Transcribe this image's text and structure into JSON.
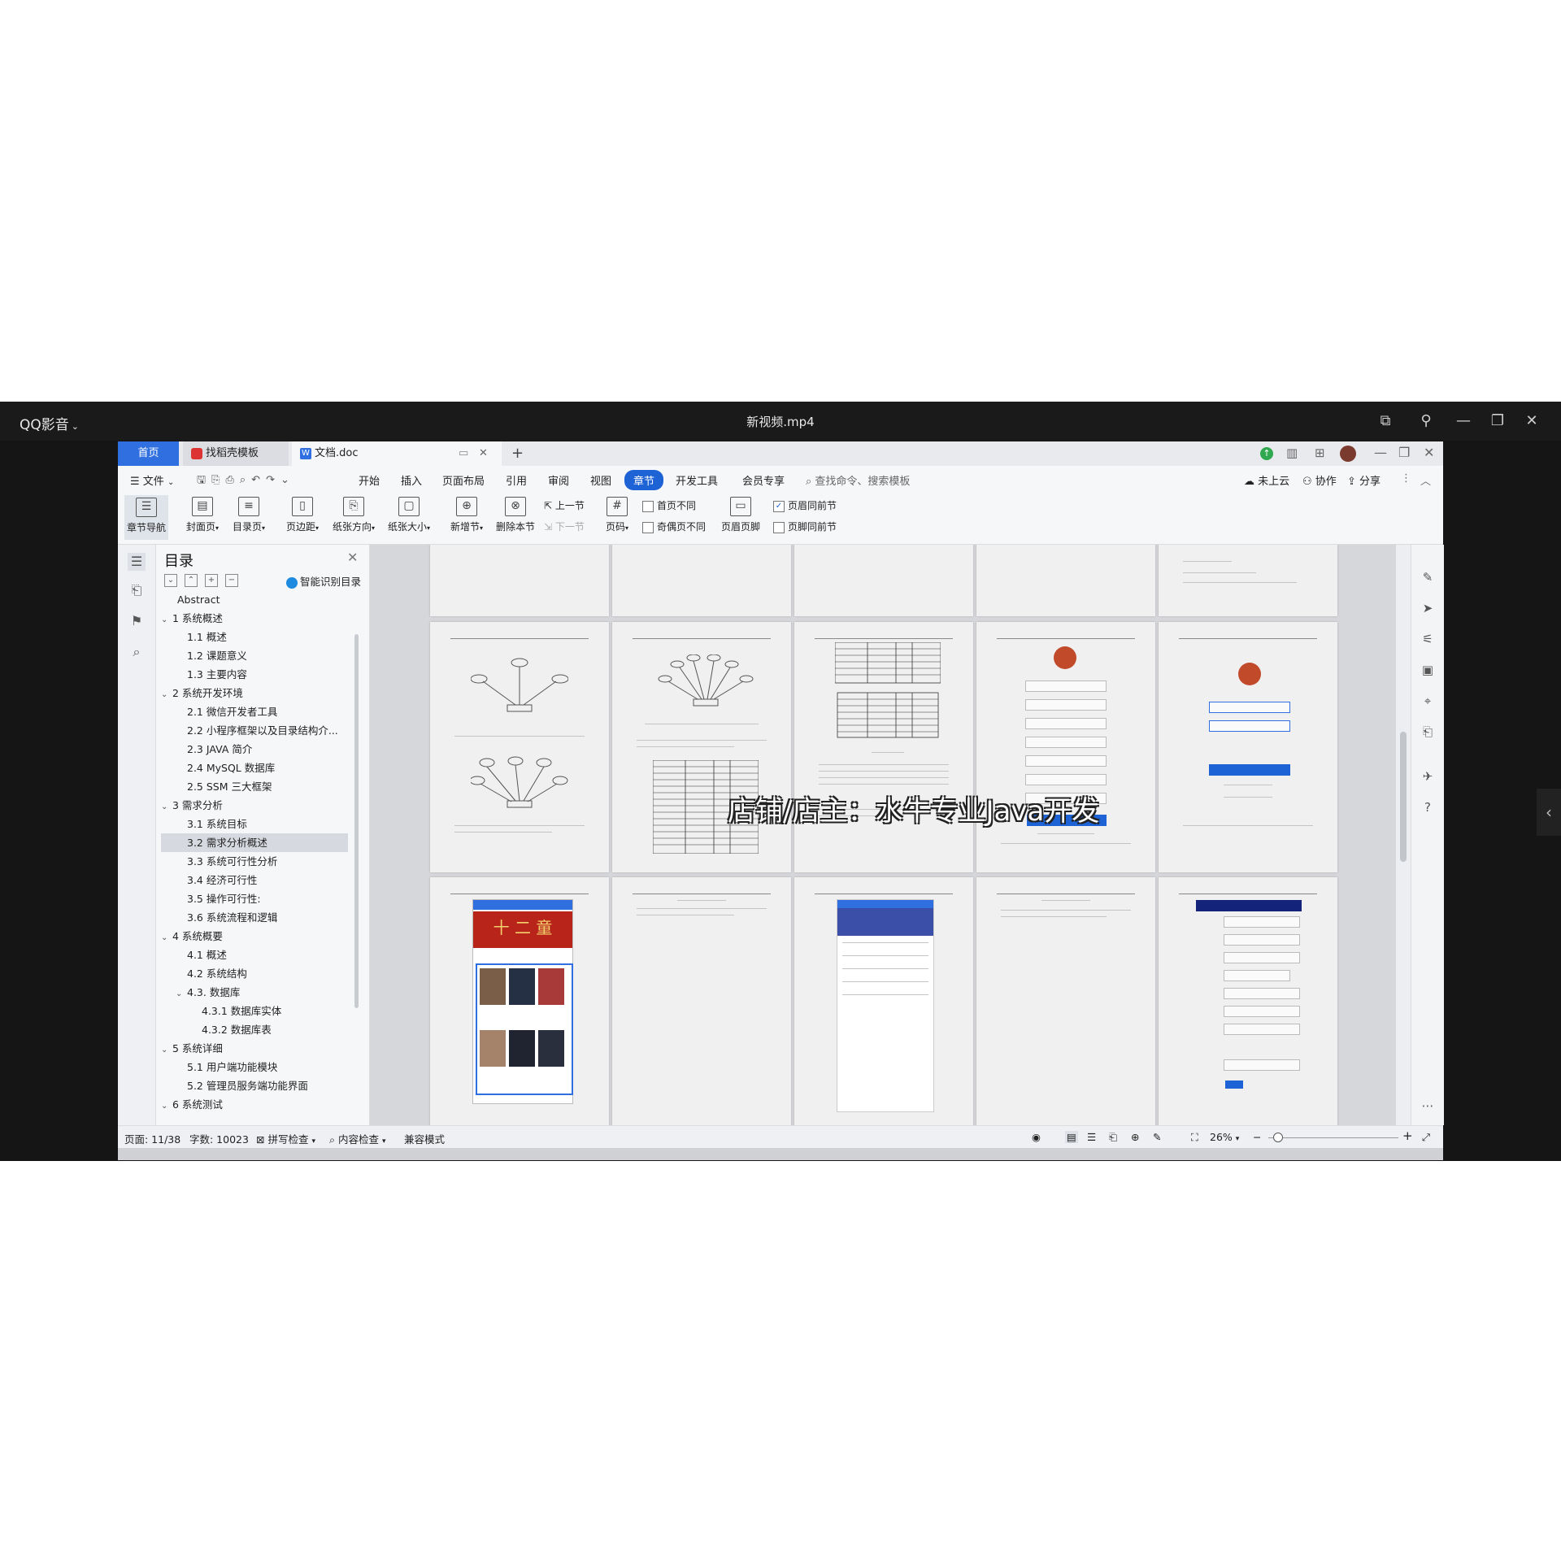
{
  "player": {
    "app_name": "QQ影音",
    "video_title": "新视频.mp4",
    "controls": [
      "pip",
      "pin",
      "minimize",
      "restore",
      "close"
    ]
  },
  "wps": {
    "tabs": [
      {
        "label": "首页",
        "active": false
      },
      {
        "label": "找稻壳模板",
        "active": false
      },
      {
        "label": "文档.doc",
        "active": true
      }
    ],
    "new_tab": "+",
    "file_menu": "文件",
    "menu": [
      "开始",
      "插入",
      "页面布局",
      "引用",
      "审阅",
      "视图",
      "章节",
      "开发工具",
      "会员专享"
    ],
    "active_menu": "章节",
    "search_placeholder": "查找命令、搜索模板",
    "right_actions": [
      "未上云",
      "协作",
      "分享"
    ],
    "ribbon": {
      "chapter_nav": "章节导航",
      "cover": "封面页",
      "toc_page": "目录页",
      "margins": "页边距",
      "orientation": "纸张方向",
      "size": "纸张大小",
      "new_section": "新增节",
      "delete_section": "删除本节",
      "prev_section": "上一节",
      "next_section": "下一节",
      "page_number": "页码",
      "first_page_diff": "首页不同",
      "odd_even_diff": "奇偶页不同",
      "header_footer": "页眉页脚",
      "header_same": "页眉同前节",
      "footer_same": "页脚同前节"
    },
    "nav": {
      "title": "目录",
      "smart_toc": "智能识别目录",
      "items": [
        {
          "text": "Abstract",
          "level": 0,
          "arrow": false
        },
        {
          "text": "1 系统概述",
          "level": 0,
          "arrow": true
        },
        {
          "text": "1.1 概述",
          "level": 1,
          "arrow": false
        },
        {
          "text": "1.2 课题意义",
          "level": 1,
          "arrow": false
        },
        {
          "text": "1.3 主要内容",
          "level": 1,
          "arrow": false
        },
        {
          "text": "2 系统开发环境",
          "level": 0,
          "arrow": true
        },
        {
          "text": "2.1 微信开发者工具",
          "level": 1,
          "arrow": false
        },
        {
          "text": "2.2 小程序框架以及目录结构介...",
          "level": 1,
          "arrow": false
        },
        {
          "text": "2.3 JAVA 简介",
          "level": 1,
          "arrow": false
        },
        {
          "text": "2.4 MySQL 数据库",
          "level": 1,
          "arrow": false
        },
        {
          "text": "2.5 SSM 三大框架",
          "level": 1,
          "arrow": false
        },
        {
          "text": "3 需求分析",
          "level": 0,
          "arrow": true
        },
        {
          "text": "3.1 系统目标",
          "level": 1,
          "arrow": false
        },
        {
          "text": "3.2 需求分析概述",
          "level": 1,
          "arrow": false,
          "selected": true
        },
        {
          "text": "3.3 系统可行性分析",
          "level": 1,
          "arrow": false
        },
        {
          "text": "3.4 经济可行性",
          "level": 1,
          "arrow": false
        },
        {
          "text": "3.5 操作可行性:",
          "level": 1,
          "arrow": false
        },
        {
          "text": "3.6 系统流程和逻辑",
          "level": 1,
          "arrow": false
        },
        {
          "text": "4 系统概要",
          "level": 0,
          "arrow": true
        },
        {
          "text": "4.1 概述",
          "level": 1,
          "arrow": false
        },
        {
          "text": "4.2 系统结构",
          "level": 1,
          "arrow": false
        },
        {
          "text": "4.3. 数据库",
          "level": 1,
          "arrow": true
        },
        {
          "text": "4.3.1 数据库实体",
          "level": 2,
          "arrow": false
        },
        {
          "text": "4.3.2 数据库表",
          "level": 2,
          "arrow": false
        },
        {
          "text": "5 系统详细",
          "level": 0,
          "arrow": true
        },
        {
          "text": "5.1 用户端功能模块",
          "level": 1,
          "arrow": false
        },
        {
          "text": "5.2 管理员服务端功能界面",
          "level": 1,
          "arrow": false
        },
        {
          "text": "6 系统测试",
          "level": 0,
          "arrow": true
        }
      ]
    },
    "document": {
      "watermark": "店铺/店主：水牛专业Java开发",
      "banner_text": "十 二 童"
    },
    "status": {
      "page": "页面: 11/38",
      "words": "字数: 10023",
      "spell": "拼写检查",
      "content": "内容检查",
      "compat": "兼容模式",
      "zoom": "26%"
    }
  },
  "colors": {
    "accent": "#1e63d5",
    "player_bg": "#151515",
    "tab_home": "#2f6fe0"
  }
}
